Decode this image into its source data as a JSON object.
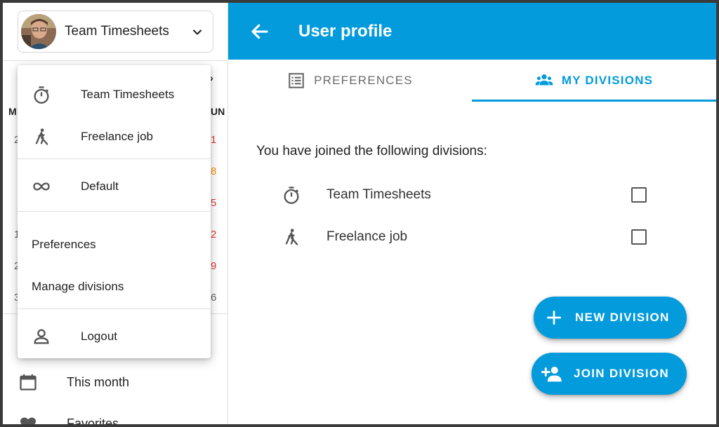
{
  "account": {
    "name": "Team Timesheets"
  },
  "calendar_fragments": {
    "nav": "»",
    "col_left": "M",
    "col_right": "UN",
    "left_dates": [
      "2",
      "1",
      "2",
      "3"
    ],
    "right_dates": [
      "1",
      "8",
      "5",
      "2",
      "9",
      "6"
    ]
  },
  "menu": {
    "divisions": [
      {
        "label": "Team Timesheets",
        "icon": "stopwatch-icon"
      },
      {
        "label": "Freelance job",
        "icon": "person-working-icon"
      }
    ],
    "default": {
      "label": "Default",
      "icon": "infinity-icon"
    },
    "preferences": "Preferences",
    "manage": "Manage divisions",
    "logout": {
      "label": "Logout",
      "icon": "person-icon"
    }
  },
  "sidebar": {
    "this_month": {
      "label": "This month",
      "icon": "calendar-icon"
    },
    "favorites": {
      "label": "Favorites",
      "icon": "heart-icon"
    }
  },
  "appbar": {
    "title": "User profile",
    "back_icon": "arrow-left-icon"
  },
  "tabs": [
    {
      "label": "PREFERENCES",
      "icon": "list-icon",
      "active": false
    },
    {
      "label": "MY DIVISIONS",
      "icon": "group-icon",
      "active": true
    }
  ],
  "divisions_section": {
    "intro": "You have joined the following divisions:",
    "items": [
      {
        "label": "Team Timesheets",
        "icon": "stopwatch-icon",
        "checked": false
      },
      {
        "label": "Freelance job",
        "icon": "person-working-icon",
        "checked": false
      }
    ]
  },
  "actions": {
    "new_division": "NEW DIVISION",
    "join_division": "JOIN DIVISION"
  },
  "colors": {
    "primary": "#039bdc",
    "weekend_red": "#e53935",
    "today_orange": "#fb8c00"
  }
}
